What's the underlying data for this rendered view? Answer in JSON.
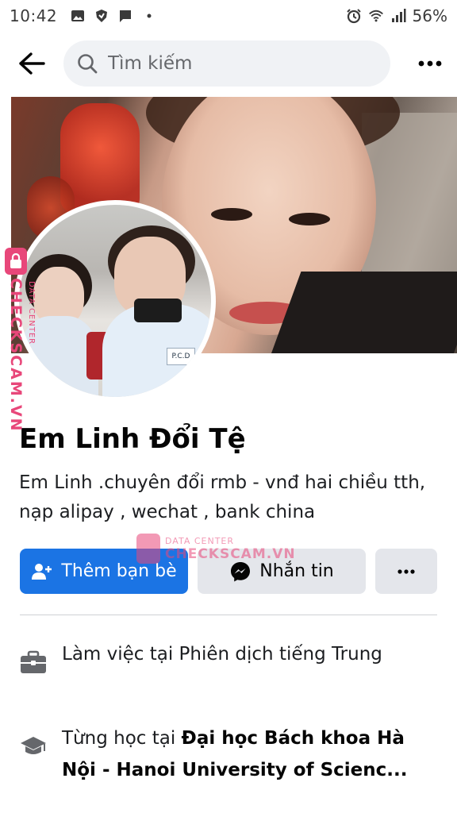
{
  "status_bar": {
    "time": "10:42",
    "battery": "56%",
    "left_icons": [
      "gallery-icon",
      "shield-icon",
      "message-icon",
      "dot-icon"
    ],
    "right_icons": [
      "alarm-icon",
      "wifi-icon",
      "signal-icon"
    ]
  },
  "top_bar": {
    "search_placeholder": "Tìm kiếm"
  },
  "profile": {
    "name": "Em Linh Đổi Tệ",
    "bio": "Em Linh .chuyên đổi rmb - vnđ hai chiều tth, nạp alipay , wechat , bank china"
  },
  "actions": {
    "add_friend_label": "Thêm bạn bè",
    "message_label": "Nhắn tin"
  },
  "info": {
    "work": "Làm việc tại Phiên dịch tiếng Trung",
    "education_prefix": "Từng học tại ",
    "education_school": "Đại học Bách khoa Hà Nội - Hanoi University of Scienc..."
  },
  "watermark": {
    "vertical_brand": "CHECKSCAM.VN",
    "vertical_sub": "DATA CENTER",
    "horizontal_sub": "DATA CENTER",
    "horizontal_brand": "CHECKSCAM.VN"
  },
  "avatar_badge": "P.C.D",
  "colors": {
    "primary": "#1b74e4",
    "secondary_button": "#e4e6eb",
    "watermark": "#e8477a"
  }
}
